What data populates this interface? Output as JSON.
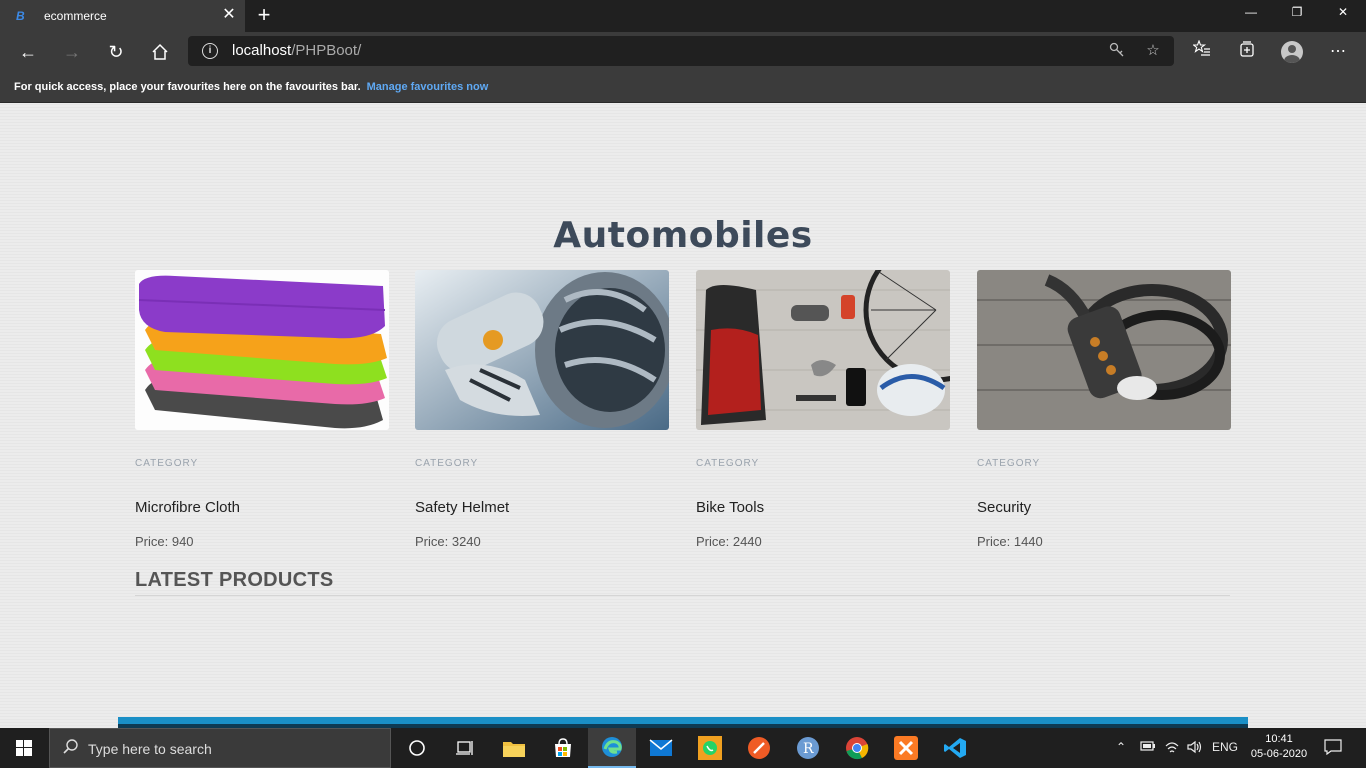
{
  "browser": {
    "tab_title": "ecommerce",
    "tab_favicon": "B",
    "url_host": "localhost",
    "url_path": "/PHPBoot/",
    "favbar_message": "For quick access, place your favourites here on the favourites bar.",
    "favbar_link": "Manage favourites now"
  },
  "page": {
    "heading": "Automobiles",
    "products": [
      {
        "category": "CATEGORY",
        "name": "Microfibre Cloth",
        "price": "Price: 940",
        "image": "stacked-cloths-image"
      },
      {
        "category": "CATEGORY",
        "name": "Safety Helmet",
        "price": "Price: 3240",
        "image": "helmet-gloves-bottle-image"
      },
      {
        "category": "CATEGORY",
        "name": "Bike Tools",
        "price": "Price: 2440",
        "image": "bike-gear-flatlay-image"
      },
      {
        "category": "CATEGORY",
        "name": "Security",
        "price": "Price: 1440",
        "image": "cable-lock-image"
      }
    ],
    "latest_heading": "LATEST PRODUCTS"
  },
  "taskbar": {
    "search_placeholder": "Type here to search",
    "language": "ENG",
    "time": "10:41",
    "date": "05-06-2020",
    "apps": [
      "cortana-icon",
      "task-view-icon",
      "file-explorer-icon",
      "store-icon",
      "edge-icon",
      "mail-icon",
      "whatsapp-icon",
      "postman-icon",
      "r-icon",
      "chrome-icon",
      "xampp-icon",
      "vscode-icon"
    ]
  },
  "colors": {
    "accent_link": "#5fa9f4",
    "heading": "#3d4a5a",
    "footer_bar": "#1a8fc6"
  }
}
